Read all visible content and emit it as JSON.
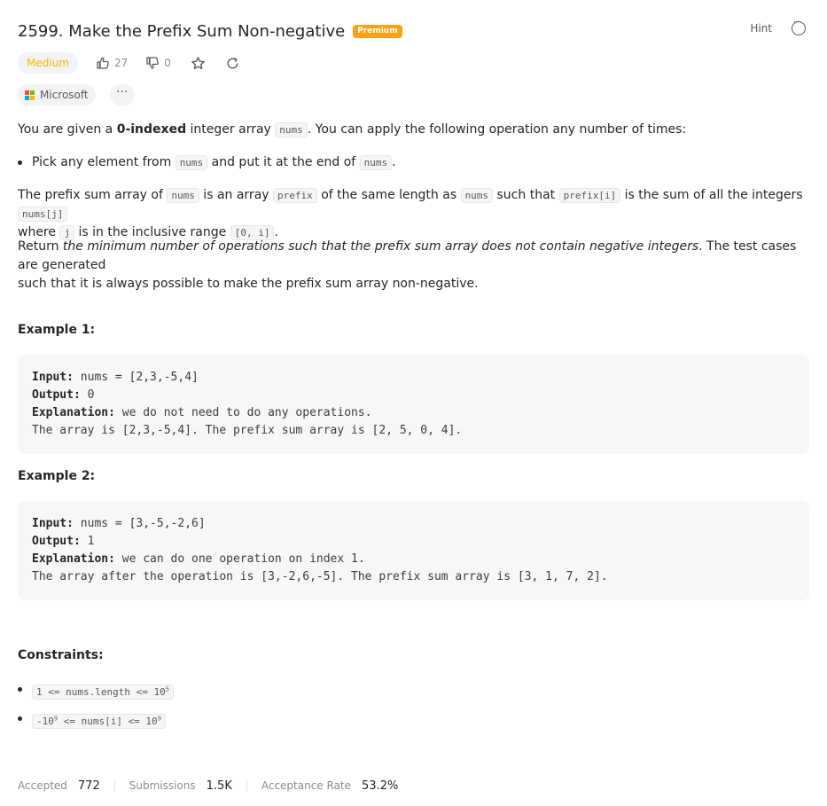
{
  "problem": {
    "title": "2599. Make the Prefix Sum Non-negative",
    "premium_badge": "Premium",
    "hint_label": "Hint",
    "difficulty": "Medium",
    "likes": "27",
    "dislikes": "0",
    "company": "Microsoft",
    "tag_more": "···"
  },
  "description": {
    "p1_a": "You are given a ",
    "p1_bold": "0-indexed",
    "p1_b": " integer array ",
    "p1_code": "nums",
    "p1_c": ". You can apply the following operation any number of times:",
    "bullet_a": "Pick any element from ",
    "bullet_code1": "nums",
    "bullet_b": " and put it at the end of ",
    "bullet_code2": "nums",
    "bullet_c": ".",
    "p2_a": "The prefix sum array of ",
    "p2_code1": "nums",
    "p2_b": " is an array ",
    "p2_code2": "prefix",
    "p2_c": " of the same length as ",
    "p2_code3": "nums",
    "p2_d": " such that ",
    "p2_code4": "prefix[i]",
    "p2_e": " is the sum of all the integers ",
    "p2_code5": "nums[j]",
    "p2_f": "where ",
    "p2_code6": "j",
    "p2_g": " is in the inclusive range ",
    "p2_code7": "[0, i]",
    "p2_h": ".",
    "p3_a": "Return ",
    "p3_italic": "the minimum number of operations such that the prefix sum array does not contain negative integers",
    "p3_b": ". The test cases are generated",
    "p3_line2": "such that it is always possible to make the prefix sum array non-negative."
  },
  "examples": [
    {
      "heading": "Example 1:",
      "input_label": "Input:",
      "input": " nums = [2,3,-5,4]",
      "output_label": "Output:",
      "output": " 0",
      "explanation_label": "Explanation:",
      "explanation": " we do not need to do any operations.",
      "extra": "The array is [2,3,-5,4]. The prefix sum array is [2, 5, 0, 4]."
    },
    {
      "heading": "Example 2:",
      "input_label": "Input:",
      "input": " nums = [3,-5,-2,6]",
      "output_label": "Output:",
      "output": " 1",
      "explanation_label": "Explanation:",
      "explanation": " we can do one operation on index 1.",
      "extra": "The array after the operation is [3,-2,6,-5]. The prefix sum array is [3, 1, 7, 2]."
    }
  ],
  "constraints": {
    "heading": "Constraints:",
    "c1_a": "1 <= nums.length <= 10",
    "c1_sup": "5",
    "c2_a": "-10",
    "c2_sup1": "9",
    "c2_b": " <= nums[i] <= 10",
    "c2_sup2": "9"
  },
  "stats": {
    "accepted_label": "Accepted",
    "accepted": "772",
    "submissions_label": "Submissions",
    "submissions": "1.5K",
    "rate_label": "Acceptance Rate",
    "rate": "53.2%"
  }
}
